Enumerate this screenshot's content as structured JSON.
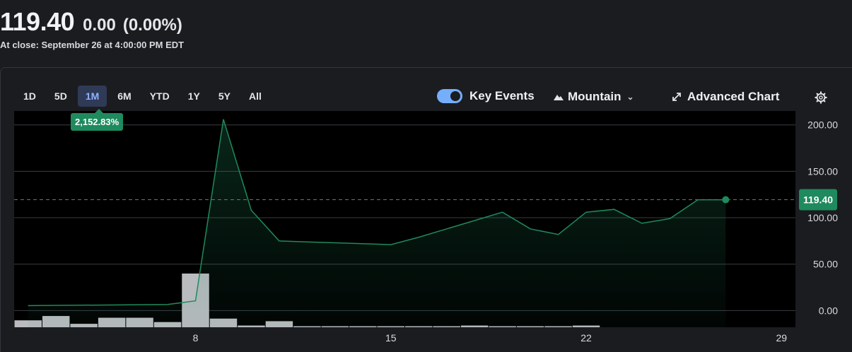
{
  "quote": {
    "price": "119.40",
    "change": "0.00",
    "change_pct": "(0.00%)",
    "close_note": "At close: September 26 at 4:00:00 PM EDT"
  },
  "ranges": [
    "1D",
    "5D",
    "1M",
    "6M",
    "YTD",
    "1Y",
    "5Y",
    "All"
  ],
  "active_range": "1M",
  "range_change_badge": "2,152.83%",
  "controls": {
    "key_events": "Key Events",
    "key_events_on": true,
    "chart_style": "Mountain",
    "advanced_chart": "Advanced Chart"
  },
  "colors": {
    "line": "#1f8a5c",
    "accent_green": "#1e8a5e",
    "toggle": "#74aefc",
    "volume_bar": "#b9bbbf"
  },
  "chart_data": {
    "type": "area",
    "x": [
      2,
      3,
      4,
      5,
      6,
      7,
      8,
      9,
      10,
      11,
      12,
      13,
      14,
      15,
      16,
      17,
      18,
      19,
      20,
      21,
      22,
      23,
      24,
      25,
      26,
      27,
      28,
      29
    ],
    "x_tick_labels": [
      "8",
      "15",
      "22",
      "29"
    ],
    "x_tick_values": [
      8,
      15,
      22,
      29
    ],
    "series": [
      {
        "price_points": [
          {
            "x": 2,
            "y": 5.3
          },
          {
            "x": 7,
            "y": 6.5
          },
          {
            "x": 8,
            "y": 10.5
          },
          {
            "x": 9,
            "y": 206
          },
          {
            "x": 10,
            "y": 108
          },
          {
            "x": 11,
            "y": 75
          },
          {
            "x": 12,
            "y": 74
          },
          {
            "x": 13,
            "y": 73
          },
          {
            "x": 14,
            "y": 72
          },
          {
            "x": 15,
            "y": 71
          },
          {
            "x": 16,
            "y": 79
          },
          {
            "x": 17,
            "y": 88
          },
          {
            "x": 18,
            "y": 97
          },
          {
            "x": 19,
            "y": 106
          },
          {
            "x": 20,
            "y": 88
          },
          {
            "x": 21,
            "y": 82
          },
          {
            "x": 22,
            "y": 106
          },
          {
            "x": 23,
            "y": 109
          },
          {
            "x": 24,
            "y": 94
          },
          {
            "x": 25,
            "y": 99
          },
          {
            "x": 26,
            "y": 119.4
          },
          {
            "x": 27,
            "y": 119.4
          }
        ]
      }
    ],
    "volume": [
      {
        "x": 2,
        "v": 8
      },
      {
        "x": 3,
        "v": 13
      },
      {
        "x": 4,
        "v": 4
      },
      {
        "x": 5,
        "v": 11
      },
      {
        "x": 6,
        "v": 11
      },
      {
        "x": 7,
        "v": 6
      },
      {
        "x": 8,
        "v": 62
      },
      {
        "x": 9,
        "v": 10
      },
      {
        "x": 10,
        "v": 2
      },
      {
        "x": 11,
        "v": 7
      },
      {
        "x": 12,
        "v": 1
      },
      {
        "x": 13,
        "v": 1
      },
      {
        "x": 14,
        "v": 1
      },
      {
        "x": 15,
        "v": 1
      },
      {
        "x": 16,
        "v": 0.5
      },
      {
        "x": 17,
        "v": 0.5
      },
      {
        "x": 18,
        "v": 2
      },
      {
        "x": 19,
        "v": 1
      },
      {
        "x": 20,
        "v": 1
      },
      {
        "x": 21,
        "v": 1
      },
      {
        "x": 22,
        "v": 2
      }
    ],
    "y_ticks": [
      0,
      50,
      100,
      150,
      200
    ],
    "y_tick_labels": [
      "0.00",
      "50.00",
      "100.00",
      "150.00",
      "200.00"
    ],
    "ylim": [
      -18,
      215
    ],
    "last_value_label": "119.40",
    "last_value": 119.4,
    "grid": true
  }
}
